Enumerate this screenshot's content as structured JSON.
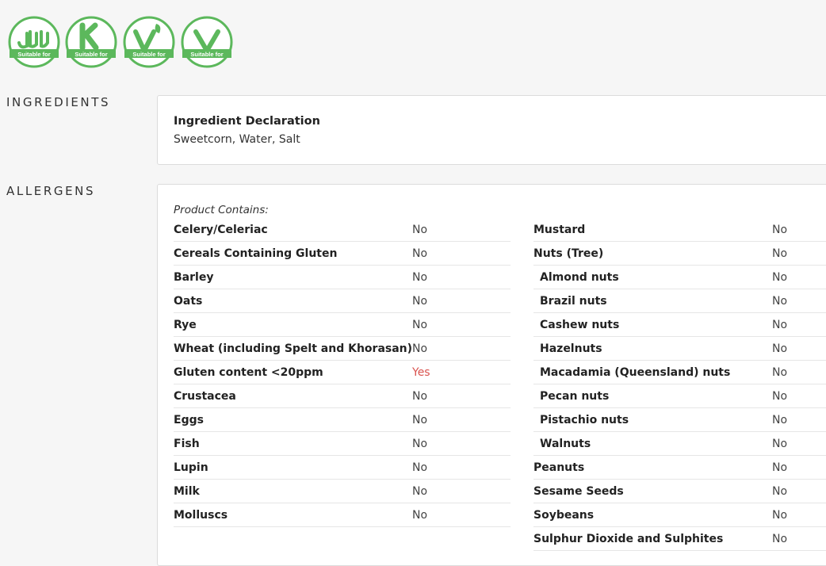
{
  "badges": [
    {
      "icon": "halal-icon",
      "caption": "Suitable for",
      "color": "#5cb85c"
    },
    {
      "icon": "kosher-icon",
      "caption": "Suitable for",
      "color": "#5cb85c"
    },
    {
      "icon": "vegetarian-icon",
      "caption": "Suitable for",
      "color": "#5cb85c"
    },
    {
      "icon": "vegan-icon",
      "caption": "Suitable for",
      "color": "#5cb85c"
    }
  ],
  "ingredients": {
    "label": "INGREDIENTS",
    "title": "Ingredient Declaration",
    "text": "Sweetcorn, Water, Salt"
  },
  "allergens": {
    "label": "ALLERGENS",
    "contains_label": "Product Contains:",
    "left": [
      {
        "name": "Celery/Celeriac",
        "value": "No"
      },
      {
        "name": "Cereals Containing Gluten",
        "value": "No"
      },
      {
        "name": "Barley",
        "value": "No"
      },
      {
        "name": "Oats",
        "value": "No"
      },
      {
        "name": "Rye",
        "value": "No"
      },
      {
        "name": "Wheat (including Spelt and Khorasan)",
        "value": "No"
      },
      {
        "name": "Gluten content <20ppm",
        "value": "Yes"
      },
      {
        "name": "Crustacea",
        "value": "No"
      },
      {
        "name": "Eggs",
        "value": "No"
      },
      {
        "name": "Fish",
        "value": "No"
      },
      {
        "name": "Lupin",
        "value": "No"
      },
      {
        "name": "Milk",
        "value": "No"
      },
      {
        "name": "Molluscs",
        "value": "No"
      }
    ],
    "right": [
      {
        "name": "Mustard",
        "value": "No"
      },
      {
        "name": "Nuts (Tree)",
        "value": "No"
      },
      {
        "name": "Almond nuts",
        "value": "No",
        "sub": true
      },
      {
        "name": "Brazil nuts",
        "value": "No",
        "sub": true
      },
      {
        "name": "Cashew nuts",
        "value": "No",
        "sub": true
      },
      {
        "name": "Hazelnuts",
        "value": "No",
        "sub": true
      },
      {
        "name": "Macadamia (Queensland) nuts",
        "value": "No",
        "sub": true
      },
      {
        "name": "Pecan nuts",
        "value": "No",
        "sub": true
      },
      {
        "name": "Pistachio nuts",
        "value": "No",
        "sub": true
      },
      {
        "name": "Walnuts",
        "value": "No",
        "sub": true
      },
      {
        "name": "Peanuts",
        "value": "No"
      },
      {
        "name": "Sesame Seeds",
        "value": "No"
      },
      {
        "name": "Soybeans",
        "value": "No"
      },
      {
        "name": "Sulphur Dioxide and Sulphites",
        "value": "No"
      }
    ]
  }
}
